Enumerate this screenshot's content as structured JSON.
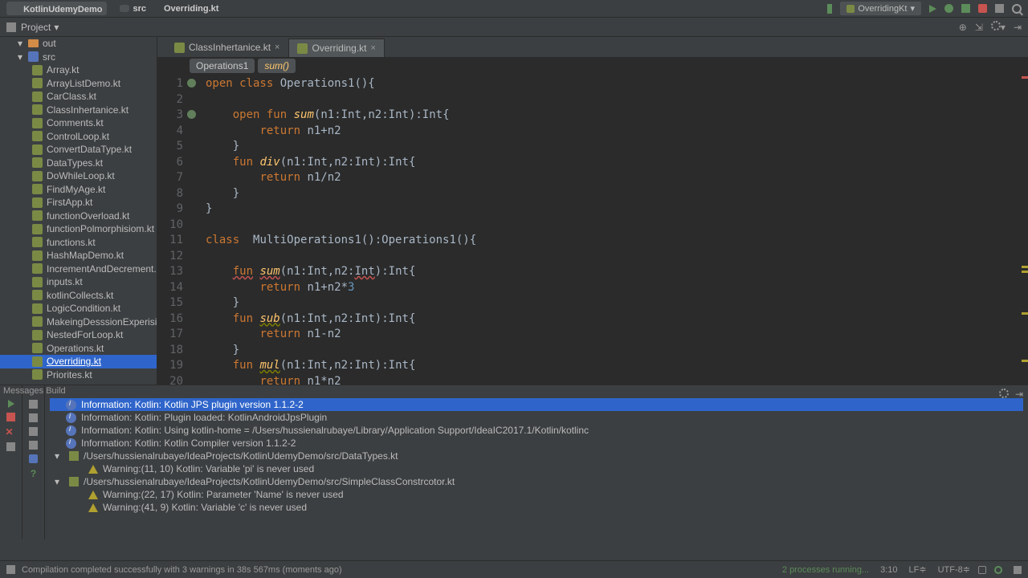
{
  "topbar": {
    "project": "KotlinUdemyDemo",
    "folder": "src",
    "file": "Overriding.kt",
    "config": "OverridingKt"
  },
  "toolrow": {
    "label": "Project"
  },
  "tree": {
    "items": [
      {
        "d": 0,
        "type": "fold",
        "label": "out",
        "exp": "▾"
      },
      {
        "d": 0,
        "type": "mod",
        "label": "src",
        "exp": "▾"
      },
      {
        "d": 1,
        "type": "kfile",
        "label": "Array.kt"
      },
      {
        "d": 1,
        "type": "kfile",
        "label": "ArrayListDemo.kt"
      },
      {
        "d": 1,
        "type": "kfile",
        "label": "CarClass.kt"
      },
      {
        "d": 1,
        "type": "kfile",
        "label": "ClassInhertanice.kt"
      },
      {
        "d": 1,
        "type": "kfile",
        "label": "Comments.kt"
      },
      {
        "d": 1,
        "type": "kfile",
        "label": "ControlLoop.kt"
      },
      {
        "d": 1,
        "type": "kfile",
        "label": "ConvertDataType.kt"
      },
      {
        "d": 1,
        "type": "kfile",
        "label": "DataTypes.kt"
      },
      {
        "d": 1,
        "type": "kfile",
        "label": "DoWhileLoop.kt"
      },
      {
        "d": 1,
        "type": "kfile",
        "label": "FindMyAge.kt"
      },
      {
        "d": 1,
        "type": "kfile",
        "label": "FirstApp.kt"
      },
      {
        "d": 1,
        "type": "kfile",
        "label": "functionOverload.kt"
      },
      {
        "d": 1,
        "type": "kfile",
        "label": "functionPolmorphisiom.kt"
      },
      {
        "d": 1,
        "type": "kfile",
        "label": "functions.kt"
      },
      {
        "d": 1,
        "type": "kfile",
        "label": "HashMapDemo.kt"
      },
      {
        "d": 1,
        "type": "kfile",
        "label": "IncrementAndDecrement.k"
      },
      {
        "d": 1,
        "type": "kfile",
        "label": "inputs.kt"
      },
      {
        "d": 1,
        "type": "kfile",
        "label": "kotlinCollects.kt"
      },
      {
        "d": 1,
        "type": "kfile",
        "label": "LogicCondition.kt"
      },
      {
        "d": 1,
        "type": "kfile",
        "label": "MakeingDesssionExperisi"
      },
      {
        "d": 1,
        "type": "kfile",
        "label": "NestedForLoop.kt"
      },
      {
        "d": 1,
        "type": "kfile",
        "label": "Operations.kt"
      },
      {
        "d": 1,
        "type": "kfile",
        "label": "Overriding.kt",
        "sel": true
      },
      {
        "d": 1,
        "type": "kfile",
        "label": "Priorites.kt"
      }
    ]
  },
  "tabs": [
    {
      "label": "ClassInhertanice.kt",
      "active": false
    },
    {
      "label": "Overriding.kt",
      "active": true
    }
  ],
  "breadcrumb": {
    "cls": "Operations1",
    "fn": "sum()"
  },
  "code": {
    "lines": [
      {
        "n": 1,
        "mark": true,
        "html": "<span class='kw'>open class</span> <span class='cls'>Operations1</span><span class='txt'>(){</span>"
      },
      {
        "n": 2,
        "html": ""
      },
      {
        "n": 3,
        "mark": true,
        "html": "    <span class='kw'>open </span><span class='kw'>fun</span> <span class='fn'>sum</span><span class='txt'>(n1:</span><span class='ty'>Int</span><span class='txt'>,n2:</span><span class='ty'>Int</span><span class='txt'>):</span><span class='ty'>Int</span><span class='txt'>{</span>"
      },
      {
        "n": 4,
        "html": "        <span class='kw'>return</span> <span class='txt'>n1+n2</span>"
      },
      {
        "n": 5,
        "html": "    <span class='txt'>}</span>"
      },
      {
        "n": 6,
        "html": "    <span class='kw'>fun</span> <span class='fn'>div</span><span class='txt'>(n1:</span><span class='ty'>Int</span><span class='txt'>,n2:</span><span class='ty'>Int</span><span class='txt'>):</span><span class='ty'>Int</span><span class='txt'>{</span>"
      },
      {
        "n": 7,
        "html": "        <span class='kw'>return</span> <span class='txt'>n1/n2</span>"
      },
      {
        "n": 8,
        "html": "    <span class='txt'>}</span>"
      },
      {
        "n": 9,
        "html": "<span class='txt'>}</span>"
      },
      {
        "n": 10,
        "html": ""
      },
      {
        "n": 11,
        "html": "<span class='kw'>class</span>  <span class='cls'>MultiOperations1</span><span class='txt'>():Operations1(){</span>"
      },
      {
        "n": 12,
        "html": ""
      },
      {
        "n": 13,
        "html": "    <span class='kw err'>fun</span> <span class='fn err'>sum</span><span class='txt'>(n1:</span><span class='ty'>Int</span><span class='txt'>,n2:</span><span class='ty err'>Int</span><span class='txt'>):</span><span class='ty'>Int</span><span class='txt'>{</span>"
      },
      {
        "n": 14,
        "html": "        <span class='kw'>return</span> <span class='txt'>n1+n2*</span><span class='num'>3</span>"
      },
      {
        "n": 15,
        "html": "    <span class='txt'>}</span>"
      },
      {
        "n": 16,
        "html": "    <span class='kw'>fun</span> <span class='fn warn'>sub</span><span class='txt'>(n1:</span><span class='ty'>Int</span><span class='txt'>,n2:</span><span class='ty'>Int</span><span class='txt'>):</span><span class='ty'>Int</span><span class='txt'>{</span>"
      },
      {
        "n": 17,
        "html": "        <span class='kw'>return</span> <span class='txt'>n1-n2</span>"
      },
      {
        "n": 18,
        "html": "    <span class='txt'>}</span>"
      },
      {
        "n": 19,
        "html": "    <span class='kw'>fun</span> <span class='fn warn'>mul</span><span class='txt'>(n1:</span><span class='ty'>Int</span><span class='txt'>,n2:</span><span class='ty'>Int</span><span class='txt'>):</span><span class='ty'>Int</span><span class='txt'>{</span>"
      },
      {
        "n": 20,
        "html": "        <span class='kw'>return</span> <span class='txt'>n1*n2</span>"
      },
      {
        "n": 21,
        "html": "    <span class='txt'>}</span>"
      }
    ]
  },
  "messages": {
    "title": "Messages Build",
    "rows": [
      {
        "type": "info",
        "sel": true,
        "text": "Information: Kotlin: Kotlin JPS plugin version 1.1.2-2"
      },
      {
        "type": "info",
        "text": "Information: Kotlin: Plugin loaded: KotlinAndroidJpsPlugin"
      },
      {
        "type": "info",
        "text": "Information: Kotlin: Using kotlin-home = /Users/hussienalrubaye/Library/Application Support/IdeaIC2017.1/Kotlin/kotlinc"
      },
      {
        "type": "info",
        "text": "Information: Kotlin: Kotlin Compiler version 1.1.2-2"
      },
      {
        "type": "file",
        "exp": "▾",
        "text": "/Users/hussienalrubaye/IdeaProjects/KotlinUdemyDemo/src/DataTypes.kt"
      },
      {
        "type": "warn",
        "indent": true,
        "text": "Warning:(11, 10)  Kotlin: Variable 'pi' is never used"
      },
      {
        "type": "file",
        "exp": "▾",
        "text": "/Users/hussienalrubaye/IdeaProjects/KotlinUdemyDemo/src/SimpleClassConstrcotor.kt"
      },
      {
        "type": "warn",
        "indent": true,
        "text": "Warning:(22, 17)  Kotlin: Parameter 'Name' is never used"
      },
      {
        "type": "warn",
        "indent": true,
        "text": "Warning:(41, 9)  Kotlin: Variable 'c' is never used"
      }
    ]
  },
  "status": {
    "msg": "Compilation completed successfully with 3 warnings in 38s 567ms (moments ago)",
    "proc": "2 processes running...",
    "pos": "3:10",
    "lf": "LF≑",
    "enc": "UTF-8≑"
  }
}
